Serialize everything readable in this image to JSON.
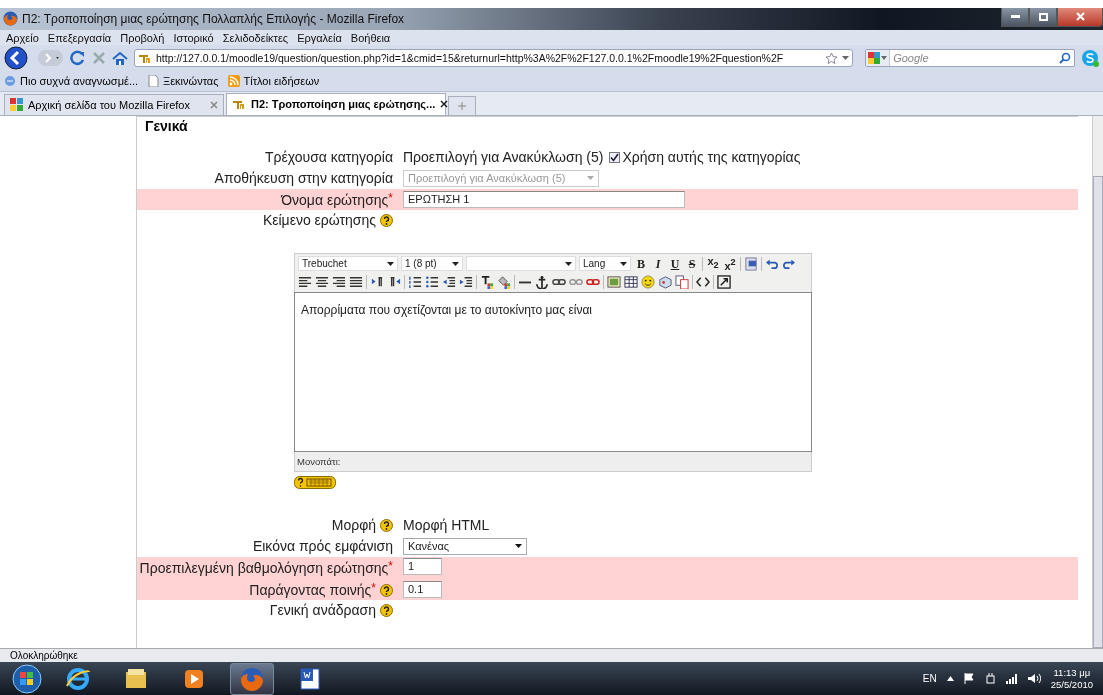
{
  "window": {
    "title": "Π2: Τροποποίηση μιας ερώτησης Πολλαπλής Επιλογής - Mozilla Firefox"
  },
  "menu": [
    "Αρχείο",
    "Επεξεργασία",
    "Προβολή",
    "Ιστορικό",
    "Σελιδοδείκτες",
    "Εργαλεία",
    "Βοήθεια"
  ],
  "address": {
    "url": "http://127.0.0.1/moodle19/question/question.php?id=1&cmid=15&returnurl=http%3A%2F%2F127.0.0.1%2Fmoodle19%2Fquestion%2F"
  },
  "search": {
    "placeholder": "Google"
  },
  "bookmarks": [
    "Πιο συχνά αναγνωσμέ...",
    "Ξεκινώντας",
    "Τίτλοι ειδήσεων"
  ],
  "tabs": [
    {
      "label": "Αρχική σελίδα του Mozilla Firefox",
      "selected": false
    },
    {
      "label": "Π2: Τροποποίηση μιας ερώτησης...",
      "selected": true
    }
  ],
  "form": {
    "legend": "Γενικά",
    "rows": [
      {
        "kind": "text",
        "label": "Τρέχουσα κατηγορία",
        "highlighted": false,
        "value": "Προεπιλογή για Ανακύκλωση (5)",
        "checkbox": {
          "label": "Χρήση αυτής της κατηγορίας",
          "checked": true
        }
      },
      {
        "kind": "select",
        "label": "Αποθήκευση στην κατηγορία",
        "highlighted": false,
        "value": "Προεπιλογή για Ανακύκλωση (5)",
        "disabled": true
      },
      {
        "kind": "input",
        "label": "Όνομα ερώτησης",
        "required_mark": "*",
        "highlighted": true,
        "value": "ΕΡΩΤΗΣΗ 1"
      },
      {
        "kind": "label",
        "label": "Κείμενο ερώτησης",
        "help": true,
        "highlighted": false
      },
      {
        "kind": "editor",
        "highlighted": false,
        "toolbar": [
          {
            "kind": "select",
            "value": "Trebuchet"
          },
          {
            "kind": "select",
            "value": "1 (8 pt)"
          },
          {
            "kind": "blank-select"
          },
          {
            "kind": "select",
            "value": "Lang"
          },
          {
            "kind": "button",
            "label": "B"
          },
          {
            "kind": "button",
            "label": "I"
          },
          {
            "kind": "button",
            "label": "U"
          },
          {
            "kind": "button",
            "label": "S"
          },
          {
            "kind": "button",
            "label": "x$_{2}$"
          },
          {
            "kind": "button",
            "label": "x$^{2}$"
          }
        ],
        "content": "Απορρίματα που σχετίζονται με το αυτοκίνητο μας είναι",
        "path_label": "Μονοπάτι:"
      },
      {
        "kind": "text",
        "label": "Μορφή",
        "help": true,
        "highlighted": false,
        "value": "Μορφή HTML"
      },
      {
        "kind": "select",
        "label": "Εικόνα πρός εμφάνιση",
        "highlighted": false,
        "value": "Κανένας",
        "disabled": false
      },
      {
        "kind": "input",
        "label": "Προεπιλεγμένη βαθμολόγηση ερώτησης",
        "required_mark": "*",
        "highlighted": true,
        "value": "1"
      },
      {
        "kind": "input",
        "label": "Παράγοντας ποινής",
        "required_mark": "*",
        "help": true,
        "highlighted": true,
        "value": "0.1"
      },
      {
        "kind": "label",
        "label": "Γενική ανάδραση",
        "help": true,
        "highlighted": false
      }
    ]
  },
  "status_bar": {
    "text": "Ολοκληρώθηκε"
  },
  "taskbar": {
    "language": "EN",
    "time": "11:13 μμ",
    "date": "25/5/2010"
  }
}
